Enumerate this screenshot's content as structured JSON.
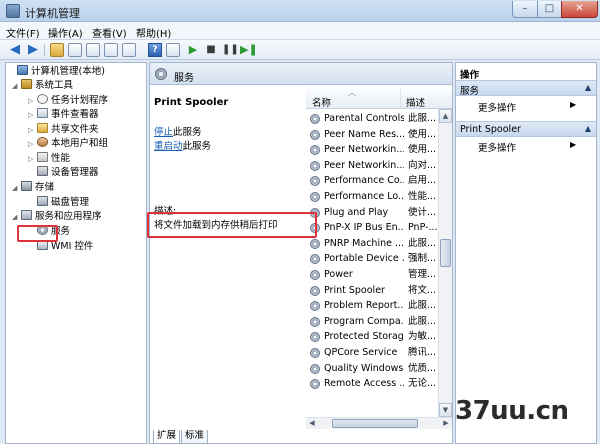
{
  "window": {
    "title": "计算机管理",
    "min_label": "–",
    "max_label": "□",
    "close_label": "✕"
  },
  "menu": {
    "items": [
      "文件(F)",
      "操作(A)",
      "查看(V)",
      "帮助(H)"
    ]
  },
  "tree": {
    "items": [
      {
        "label": "计算机管理(本地)",
        "icon": "computer-icon"
      },
      {
        "label": "系统工具",
        "icon": "tools-icon"
      },
      {
        "label": "任务计划程序",
        "icon": "clock-icon"
      },
      {
        "label": "事件查看器",
        "icon": "log-icon"
      },
      {
        "label": "共享文件夹",
        "icon": "folder-icon"
      },
      {
        "label": "本地用户和组",
        "icon": "users-icon"
      },
      {
        "label": "性能",
        "icon": "performance-icon"
      },
      {
        "label": "设备管理器",
        "icon": "device-icon"
      },
      {
        "label": "存储",
        "icon": "storage-icon"
      },
      {
        "label": "磁盘管理",
        "icon": "disk-icon"
      },
      {
        "label": "服务和应用程序",
        "icon": "apps-icon"
      },
      {
        "label": "服务",
        "icon": "gear-icon"
      },
      {
        "label": "WMI 控件",
        "icon": "wmi-icon"
      }
    ]
  },
  "center": {
    "header": "服务",
    "selected_title": "Print Spooler",
    "stop_link": "停止",
    "stop_suffix": "此服务",
    "restart_link": "重启动",
    "restart_suffix": "此服务",
    "desc_label": "描述:",
    "desc_text": "将文件加载到内存供稍后打印",
    "columns": {
      "name": "名称",
      "desc": "描述"
    },
    "services": [
      {
        "name": "Parental Controls",
        "desc": "此服..."
      },
      {
        "name": "Peer Name Res...",
        "desc": "使用..."
      },
      {
        "name": "Peer Networkin...",
        "desc": "使用..."
      },
      {
        "name": "Peer Networkin...",
        "desc": "向对..."
      },
      {
        "name": "Performance Co...",
        "desc": "启用..."
      },
      {
        "name": "Performance Lo...",
        "desc": "性能..."
      },
      {
        "name": "Plug and Play",
        "desc": "使计..."
      },
      {
        "name": "PnP-X IP Bus En...",
        "desc": "PnP-..."
      },
      {
        "name": "PNRP Machine ...",
        "desc": "此服..."
      },
      {
        "name": "Portable Device ...",
        "desc": "强制..."
      },
      {
        "name": "Power",
        "desc": "管理..."
      },
      {
        "name": "Print Spooler",
        "desc": "将文..."
      },
      {
        "name": "Problem Report...",
        "desc": "此服..."
      },
      {
        "name": "Program Compa...",
        "desc": "此服..."
      },
      {
        "name": "Protected Storage",
        "desc": "为敏..."
      },
      {
        "name": "QPCore Service",
        "desc": "腾讯..."
      },
      {
        "name": "Quality Windows...",
        "desc": "优质..."
      },
      {
        "name": "Remote Access ...",
        "desc": "无论..."
      }
    ],
    "tabs": [
      "扩展",
      "标准"
    ]
  },
  "actions": {
    "title": "操作",
    "sections": [
      {
        "label": "服务",
        "items": [
          "更多操作"
        ]
      },
      {
        "label": "Print Spooler",
        "items": [
          "更多操作"
        ]
      }
    ]
  },
  "watermark": "37uu.cn",
  "colors": {
    "highlight": "#e0313a",
    "link": "#1a5fb4"
  }
}
